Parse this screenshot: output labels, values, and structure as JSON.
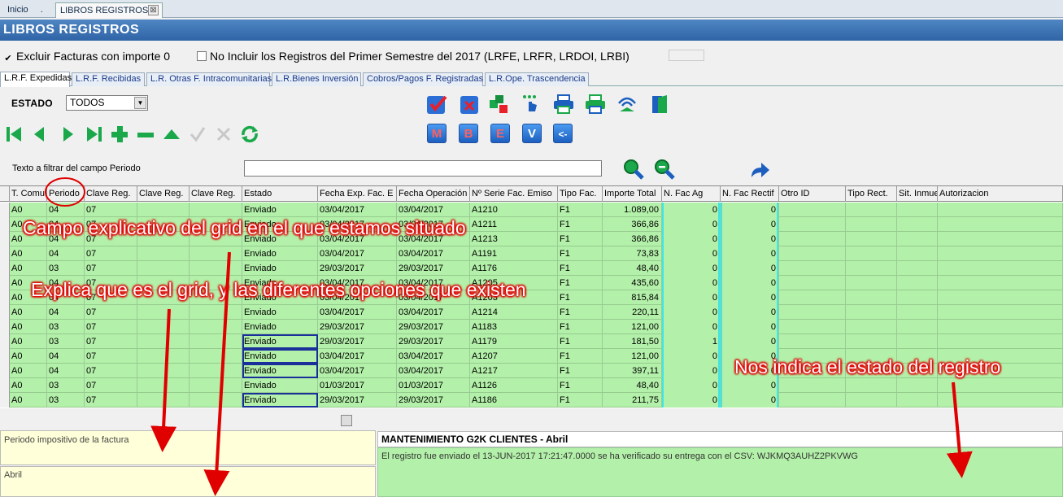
{
  "top_tabs": {
    "inicio": "Inicio",
    "sep": ".",
    "libros": "LIBROS REGISTROS",
    "close": "⊠"
  },
  "window_title": "LIBROS REGISTROS",
  "options": {
    "excluir_label": "Excluir Facturas con importe 0",
    "excluir_checked": true,
    "no_incluir_label": "No Incluir los Registros del Primer Semestre del 2017 (LRFE, LRFR, LRDOI, LRBI)",
    "no_incluir_checked": false
  },
  "sub_tabs": [
    "L.R.F. Expedidas",
    "L.R.F. Recibidas",
    "L.R. Otras F. Intracomunitarias",
    "L.R.Bienes Inversión",
    "Cobros/Pagos F. Registradas",
    "L.R.Ope. Trascendencia"
  ],
  "estado": {
    "label": "ESTADO",
    "value": "TODOS"
  },
  "letter_buttons": [
    "M",
    "B",
    "E",
    "V",
    "<-"
  ],
  "filter": {
    "label": "Texto a filtrar del campo Periodo",
    "value": ""
  },
  "grid": {
    "columns": [
      "T. Comu",
      "Periodo",
      "Clave Reg.",
      "Clave Reg.",
      "Clave Reg.",
      "Estado",
      "Fecha Exp. Fac. E",
      "Fecha Operación",
      "Nº Serie Fac. Emiso",
      "Tipo Fac.",
      "Importe Total",
      "N. Fac Ag",
      "N. Fac Rectif",
      "Otro ID",
      "Tipo Rect.",
      "Sit. Inmue",
      "Autorizacion"
    ],
    "rows": [
      [
        "A0",
        "04",
        "07",
        "",
        "",
        "Enviado",
        "03/04/2017",
        "03/04/2017",
        "A1210",
        "F1",
        "1.089,00",
        "0",
        "0",
        "",
        "",
        "",
        ""
      ],
      [
        "A0",
        "04",
        "07",
        "",
        "",
        "Enviado",
        "03/04/2017",
        "03/04/2017",
        "A1211",
        "F1",
        "366,86",
        "0",
        "0",
        "",
        "",
        "",
        ""
      ],
      [
        "A0",
        "04",
        "07",
        "",
        "",
        "Enviado",
        "03/04/2017",
        "03/04/2017",
        "A1213",
        "F1",
        "366,86",
        "0",
        "0",
        "",
        "",
        "",
        ""
      ],
      [
        "A0",
        "04",
        "07",
        "",
        "",
        "Enviado",
        "03/04/2017",
        "03/04/2017",
        "A1191",
        "F1",
        "73,83",
        "0",
        "0",
        "",
        "",
        "",
        ""
      ],
      [
        "A0",
        "03",
        "07",
        "",
        "",
        "Enviado",
        "29/03/2017",
        "29/03/2017",
        "A1176",
        "F1",
        "48,40",
        "0",
        "0",
        "",
        "",
        "",
        ""
      ],
      [
        "A0",
        "04",
        "07",
        "",
        "",
        "Enviado",
        "03/04/2017",
        "03/04/2017",
        "A1205",
        "F1",
        "435,60",
        "0",
        "0",
        "",
        "",
        "",
        ""
      ],
      [
        "A0",
        "04",
        "07",
        "",
        "",
        "Enviado",
        "03/04/2017",
        "03/04/2017",
        "A1203",
        "F1",
        "815,84",
        "0",
        "0",
        "",
        "",
        "",
        ""
      ],
      [
        "A0",
        "04",
        "07",
        "",
        "",
        "Enviado",
        "03/04/2017",
        "03/04/2017",
        "A1214",
        "F1",
        "220,11",
        "0",
        "0",
        "",
        "",
        "",
        ""
      ],
      [
        "A0",
        "03",
        "07",
        "",
        "",
        "Enviado",
        "29/03/2017",
        "29/03/2017",
        "A1183",
        "F1",
        "121,00",
        "0",
        "0",
        "",
        "",
        "",
        ""
      ],
      [
        "A0",
        "03",
        "07",
        "",
        "",
        "Enviado",
        "29/03/2017",
        "29/03/2017",
        "A1179",
        "F1",
        "181,50",
        "1",
        "0",
        "",
        "",
        "",
        ""
      ],
      [
        "A0",
        "04",
        "07",
        "",
        "",
        "Enviado",
        "03/04/2017",
        "03/04/2017",
        "A1207",
        "F1",
        "121,00",
        "0",
        "0",
        "",
        "",
        "",
        ""
      ],
      [
        "A0",
        "04",
        "07",
        "",
        "",
        "Enviado",
        "03/04/2017",
        "03/04/2017",
        "A1217",
        "F1",
        "397,11",
        "0",
        "0",
        "",
        "",
        "",
        ""
      ],
      [
        "A0",
        "03",
        "07",
        "",
        "",
        "Enviado",
        "01/03/2017",
        "01/03/2017",
        "A1126",
        "F1",
        "48,40",
        "0",
        "0",
        "",
        "",
        "",
        ""
      ],
      [
        "A0",
        "03",
        "07",
        "",
        "",
        "Enviado",
        "29/03/2017",
        "29/03/2017",
        "A1186",
        "F1",
        "211,75",
        "0",
        "0",
        "",
        "",
        "",
        ""
      ]
    ],
    "selected_estado_rows": [
      9,
      10,
      11,
      13
    ]
  },
  "description": {
    "field_help": "Periodo impositivo de la factura",
    "field_value": "Abril"
  },
  "maintenance": {
    "title": "MANTENIMIENTO G2K CLIENTES - Abril",
    "message": "El registro fue enviado el 13-JUN-2017 17:21:47.0000 se ha verificado su entrega con el CSV: WJKMQ3AUHZ2PKVWG"
  },
  "annotations": {
    "a1": "Campo explicativo del grid en el que estamos situado",
    "a2": "Explica que es el grid, y las diferentes opciones que existen",
    "a3": "Nos indica el estado del registro"
  },
  "colors": {
    "grid_row": "#b3f0a9",
    "title_bar": "#2f64a6",
    "annotation_red": "#e00000",
    "cyan_col": "#3ee6e6",
    "select_outline": "#1a2f9a"
  }
}
